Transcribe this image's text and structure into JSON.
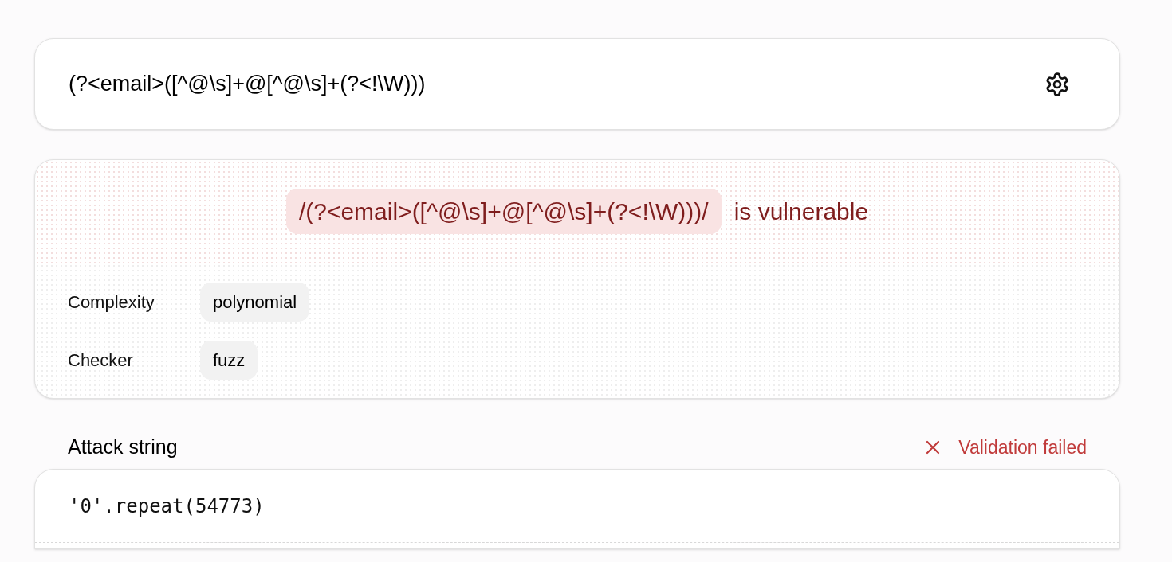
{
  "pattern_input": {
    "value": "(?<email>([^@\\s]+@[^@\\s]+(?<!\\W)))"
  },
  "result": {
    "pattern": "/(?<email>([^@\\s]+@[^@\\s]+(?<!\\W)))/",
    "verdict": "is vulnerable",
    "vulnerable": true,
    "details": [
      {
        "label": "Complexity",
        "value": "polynomial"
      },
      {
        "label": "Checker",
        "value": "fuzz"
      }
    ]
  },
  "attack": {
    "title": "Attack string",
    "validation": {
      "failed": true,
      "text": "Validation failed"
    },
    "code": "'0'.repeat(54773)"
  }
}
